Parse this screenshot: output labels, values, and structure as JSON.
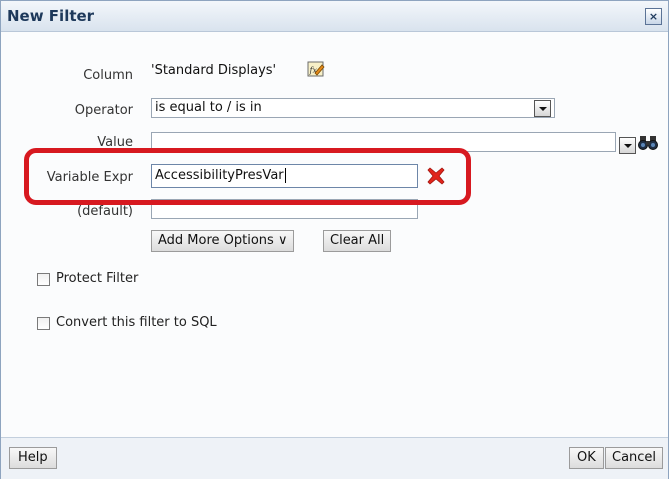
{
  "dialog": {
    "title": "New Filter",
    "close_label": "×"
  },
  "form": {
    "column_label": "Column",
    "column_value": "'Standard Displays'",
    "operator_label": "Operator",
    "operator_value": "is equal to / is in",
    "value_label": "Value",
    "value_value": "",
    "variable_expr_label": "Variable Expr",
    "variable_expr_value": "AccessibilityPresVar",
    "default_label": "(default)",
    "default_value": ""
  },
  "buttons": {
    "add_more_options": "Add More Options ∨",
    "clear_all": "Clear All",
    "help": "Help",
    "ok": "OK",
    "cancel": "Cancel"
  },
  "options": {
    "protect_filter": "Protect Filter",
    "protect_filter_checked": false,
    "convert_to_sql": "Convert this filter to SQL",
    "convert_to_sql_checked": false
  },
  "colors": {
    "highlight": "#d71920",
    "delete_icon": "#e1251b"
  }
}
